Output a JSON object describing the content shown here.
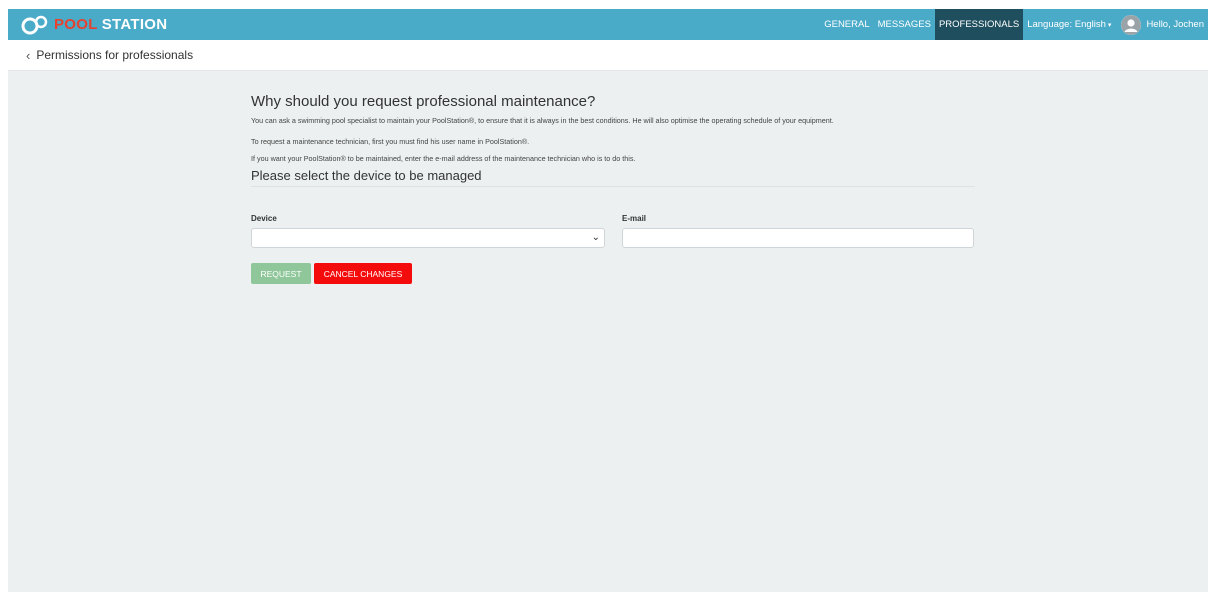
{
  "brand": {
    "part1": "POOL",
    "part2": "STATION"
  },
  "nav": {
    "general": "GENERAL",
    "messages": "MESSAGES",
    "professionals": "PROFESSIONALS",
    "language": "Language: English",
    "hello": "Hello, Jochen"
  },
  "breadcrumb": {
    "label": "Permissions for professionals"
  },
  "content": {
    "heading": "Why should you request professional maintenance?",
    "para1": "You can ask a swimming pool specialist to maintain your PoolStation®, to ensure that it is always in the best conditions. He will also optimise the operating schedule of your equipment.",
    "para2": "To request a maintenance technician, first you must find his user name in PoolStation®.",
    "para3": "If you want your PoolStation® to be maintained, enter the e-mail address of the maintenance technician who is to do this.",
    "subheading": "Please select the device to be managed"
  },
  "form": {
    "device_label": "Device",
    "device_value": "",
    "email_label": "E-mail",
    "email_value": ""
  },
  "buttons": {
    "request": "REQUEST",
    "cancel": "CANCEL CHANGES"
  },
  "colors": {
    "navbar": "#4aabc9",
    "active_nav": "#1f4f5e",
    "request": "#8fc79a",
    "cancel": "#f40c0c",
    "background": "#ecf0f0"
  }
}
